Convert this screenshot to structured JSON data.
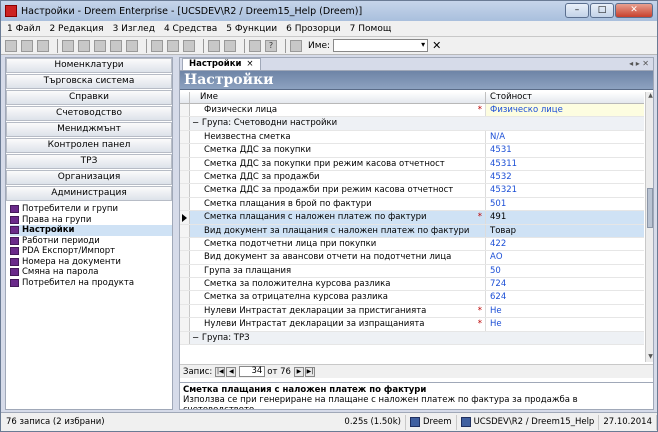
{
  "window": {
    "title": "Настройки - Dreem Enterprise - [UCSDEV\\R2 / Dreem15_Help (Dreem)]"
  },
  "menu": [
    "1 Файл",
    "2 Редакция",
    "3 Изглед",
    "4 Средства",
    "5 Функции",
    "6 Прозорци",
    "7 Помощ"
  ],
  "toolbar": {
    "name_label": "Име:",
    "name_value": ""
  },
  "nav_buttons": [
    "Номенклатури",
    "Търговска система",
    "Справки",
    "Счетоводство",
    "Мениджмънт",
    "Контролен панел",
    "ТРЗ",
    "Организация",
    "Администрация"
  ],
  "tree": [
    {
      "label": "Потребители и групи",
      "selected": false
    },
    {
      "label": "Права на групи",
      "selected": false
    },
    {
      "label": "Настройки",
      "selected": true
    },
    {
      "label": "Работни периоди",
      "selected": false
    },
    {
      "label": "PDA Експорт/Импорт",
      "selected": false
    },
    {
      "label": "Номера на документи",
      "selected": false
    },
    {
      "label": "Смяна на парола",
      "selected": false
    },
    {
      "label": "Потребител на продукта",
      "selected": false
    }
  ],
  "tab": {
    "label": "Настройки",
    "close": "×"
  },
  "header": {
    "title": "Настройки"
  },
  "grid": {
    "col_name": "Име",
    "col_value": "Стойност",
    "rows": [
      {
        "name": "Физически лица",
        "value": "Физическо лице",
        "star": true
      },
      {
        "group": "Група: Счетоводни настройки",
        "toggle": "−"
      },
      {
        "name": "Неизвестна сметка",
        "value": "N/A"
      },
      {
        "name": "Сметка ДДС за покупки",
        "value": "4531"
      },
      {
        "name": "Сметка ДДС за покупки при режим касова отчетност",
        "value": "45311"
      },
      {
        "name": "Сметка ДДС за продажби",
        "value": "4532"
      },
      {
        "name": "Сметка ДДС за продажби при режим касова отчетност",
        "value": "45321"
      },
      {
        "name": "Сметка плащания в брой по фактури",
        "value": "501"
      },
      {
        "name": "Сметка плащания с наложен платеж по фактури",
        "value": "491",
        "star": true,
        "selected": true
      },
      {
        "name": "Вид документ за плащания с наложен платеж по фактури",
        "value": "Товар",
        "alt": true
      },
      {
        "name": "Сметка подотчетни лица при покупки",
        "value": "422"
      },
      {
        "name": "Вид документ за авансови отчети на подотчетни лица",
        "value": "АО"
      },
      {
        "name": "Група за плащания",
        "value": "50"
      },
      {
        "name": "Сметка за положителна курсова разлика",
        "value": "724"
      },
      {
        "name": "Сметка за отрицателна курсова разлика",
        "value": "624"
      },
      {
        "name": "Нулеви Интрастат декларации за пристиганията",
        "value": "Не",
        "star": true
      },
      {
        "name": "Нулеви Интрастат декларации за изпращанията",
        "value": "Не",
        "star": true
      },
      {
        "group": "Група: ТРЗ",
        "toggle": "−"
      }
    ]
  },
  "navigator": {
    "label": "Запис:",
    "current": "34",
    "of_label": "от 76"
  },
  "description": {
    "title": "Сметка плащания с наложен платеж по фактури",
    "text": "Използва се при генериране на плащане с наложен платеж по фактура за продажба в счетоводството."
  },
  "status": {
    "records": "76 записа (2 избрани)",
    "timing": "0.25s (1.50k)",
    "db": "Dreem",
    "server": "UCSDEV\\R2 / Dreem15_Help",
    "date": "27.10.2014"
  }
}
